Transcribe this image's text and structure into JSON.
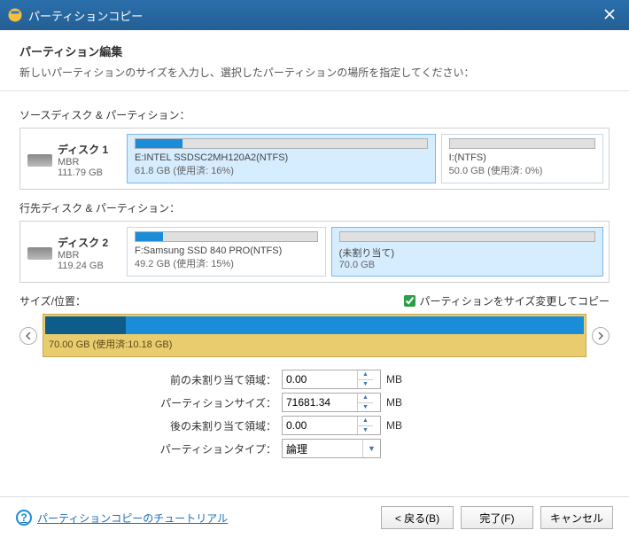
{
  "titlebar": {
    "title": "パーティションコピー"
  },
  "header": {
    "heading": "パーティション編集",
    "sub": "新しいパーティションのサイズを入力し、選択したパーティションの場所を指定してください："
  },
  "source_label": "ソースディスク & パーティション：",
  "source_disk": {
    "name": "ディスク 1",
    "scheme": "MBR",
    "size": "111.79 GB"
  },
  "source_parts": [
    {
      "name": "E:INTEL SSDSC2MH120A2(NTFS)",
      "stat": "61.8 GB (使用済: 16%)",
      "fill_pct": 16,
      "selected": true,
      "flex": 2
    },
    {
      "name": "I:(NTFS)",
      "stat": "50.0 GB (使用済: 0%)",
      "fill_pct": 0,
      "selected": false,
      "flex": 1
    }
  ],
  "dest_label": "行先ディスク & パーティション：",
  "dest_disk": {
    "name": "ディスク 2",
    "scheme": "MBR",
    "size": "119.24 GB"
  },
  "dest_parts": [
    {
      "name": "F:Samsung SSD 840 PRO(NTFS)",
      "stat": "49.2 GB (使用済: 15%)",
      "fill_pct": 15,
      "selected": false,
      "flex": 1
    },
    {
      "name": "(未割り当て)",
      "stat": "70.0 GB",
      "fill_pct": 0,
      "selected": true,
      "unalloc": true,
      "flex": 1.4
    }
  ],
  "sizepos": {
    "label": "サイズ/位置：",
    "checkbox_label": "パーティションをサイズ変更してコピー"
  },
  "slider": {
    "caption": "70.00 GB (使用済:10.18 GB)",
    "used_pct": 15
  },
  "fields": {
    "before": {
      "label": "前の未割り当て領域：",
      "value": "0.00",
      "unit": "MB"
    },
    "size": {
      "label": "パーティションサイズ：",
      "value": "71681.34",
      "unit": "MB"
    },
    "after": {
      "label": "後の未割り当て領域：",
      "value": "0.00",
      "unit": "MB"
    },
    "type": {
      "label": "パーティションタイプ：",
      "value": "論理"
    }
  },
  "footer": {
    "help": "パーティションコピーのチュートリアル",
    "back": "< 戻る(B)",
    "finish": "完了(F)",
    "cancel": "キャンセル"
  }
}
